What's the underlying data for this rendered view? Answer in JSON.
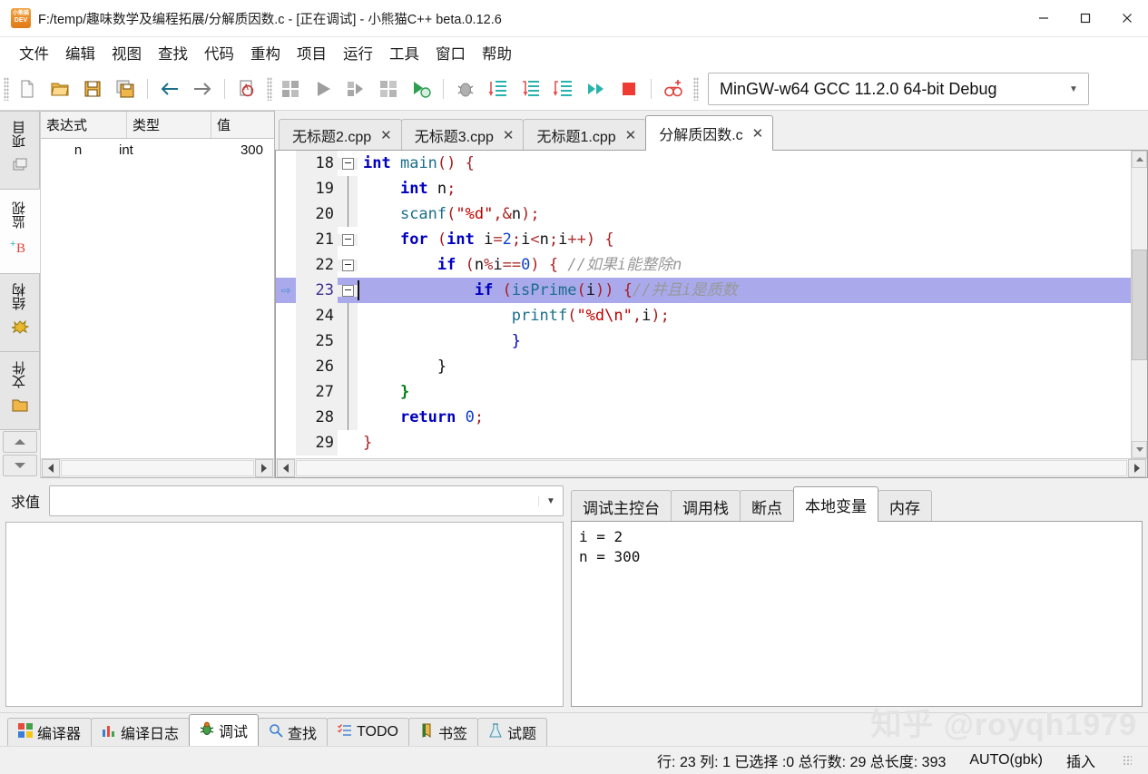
{
  "window": {
    "title": "F:/temp/趣味数学及编程拓展/分解质因数.c - [正在调试] - 小熊猫C++ beta.0.12.6",
    "app_icon": "pandadev-icon",
    "minimize_label": "—",
    "maximize_label": "□",
    "close_label": "✕"
  },
  "menu": {
    "items": [
      {
        "label": "文件",
        "name": "menu-file"
      },
      {
        "label": "编辑",
        "name": "menu-edit"
      },
      {
        "label": "视图",
        "name": "menu-view"
      },
      {
        "label": "查找",
        "name": "menu-search"
      },
      {
        "label": "代码",
        "name": "menu-code"
      },
      {
        "label": "重构",
        "name": "menu-refactor"
      },
      {
        "label": "项目",
        "name": "menu-project"
      },
      {
        "label": "运行",
        "name": "menu-run"
      },
      {
        "label": "工具",
        "name": "menu-tools"
      },
      {
        "label": "窗口",
        "name": "menu-window"
      },
      {
        "label": "帮助",
        "name": "menu-help"
      }
    ]
  },
  "toolbar": {
    "icons": [
      "new-file-icon",
      "open-folder-icon",
      "save-icon",
      "save-all-icon",
      "back-arrow-icon",
      "forward-arrow-icon",
      "find-icon",
      "compile-icon",
      "run-icon",
      "compile-run-icon",
      "rebuild-icon",
      "run-options-icon",
      "debug-bug-icon",
      "step-over-icon",
      "step-into-icon",
      "step-out-icon",
      "continue-icon",
      "stop-icon",
      "add-watch-icon"
    ],
    "compiler_set": "MinGW-w64 GCC 11.2.0 64-bit Debug",
    "compiler_arrow": "▼"
  },
  "left_dock": {
    "vertical_tabs": [
      {
        "label": "项目",
        "icon": "project-files-icon",
        "active": false,
        "name": "sidebar-tab-project"
      },
      {
        "label": "监视",
        "icon": "add-watch-icon",
        "active": true,
        "name": "sidebar-tab-watch"
      },
      {
        "label": "结构",
        "icon": "structure-icon",
        "active": false,
        "name": "sidebar-tab-structure"
      },
      {
        "label": "文件",
        "icon": "folder-icon",
        "active": false,
        "name": "sidebar-tab-files"
      }
    ],
    "scroll_up": "▲",
    "scroll_down": "▼",
    "watch": {
      "columns": [
        "表达式",
        "类型",
        "值"
      ],
      "rows": [
        {
          "expression": "n",
          "type": "int",
          "value": "300"
        }
      ]
    }
  },
  "editor": {
    "tabs": [
      {
        "label": "无标题2.cpp",
        "close": "✕",
        "active": false,
        "name": "editor-tab-untitled2"
      },
      {
        "label": "无标题3.cpp",
        "close": "✕",
        "active": false,
        "name": "editor-tab-untitled3"
      },
      {
        "label": "无标题1.cpp",
        "close": "✕",
        "active": false,
        "name": "editor-tab-untitled1"
      },
      {
        "label": "分解质因数.c",
        "close": "✕",
        "active": true,
        "name": "editor-tab-primefactor"
      }
    ],
    "current_line": 23,
    "lines": [
      {
        "n": "18",
        "marker": "",
        "fold": true,
        "highlight": false
      },
      {
        "n": "19",
        "marker": "",
        "fold": false,
        "highlight": false
      },
      {
        "n": "20",
        "marker": "",
        "fold": false,
        "highlight": false
      },
      {
        "n": "21",
        "marker": "",
        "fold": true,
        "highlight": false
      },
      {
        "n": "22",
        "marker": "",
        "fold": true,
        "highlight": false
      },
      {
        "n": "23",
        "marker": "⇨",
        "fold": true,
        "highlight": true
      },
      {
        "n": "24",
        "marker": "",
        "fold": false,
        "highlight": false
      },
      {
        "n": "25",
        "marker": "",
        "fold": false,
        "highlight": false
      },
      {
        "n": "26",
        "marker": "",
        "fold": false,
        "highlight": false
      },
      {
        "n": "27",
        "marker": "",
        "fold": false,
        "highlight": false
      },
      {
        "n": "28",
        "marker": "",
        "fold": false,
        "highlight": false
      },
      {
        "n": "29",
        "marker": "",
        "fold": false,
        "highlight": false
      }
    ],
    "code_text": [
      "int main() {",
      "    int n;",
      "    scanf(\"%d\",&n);",
      "    for (int i=2;i<n;i++) {",
      "        if (n%i==0) { //如果i能整除n",
      "            if (isPrime(i)) {//并且i是质数",
      "                printf(\"%d\\n\",i);",
      "            }",
      "        }",
      "    }",
      "    return 0;",
      "}"
    ]
  },
  "eval_panel": {
    "label": "求值",
    "input_value": "",
    "input_placeholder": "",
    "arrow": "▼",
    "output": ""
  },
  "debug_panel": {
    "tabs": [
      {
        "label": "调试主控台",
        "active": false,
        "name": "debug-tab-console"
      },
      {
        "label": "调用栈",
        "active": false,
        "name": "debug-tab-callstack"
      },
      {
        "label": "断点",
        "active": false,
        "name": "debug-tab-breakpoints"
      },
      {
        "label": "本地变量",
        "active": true,
        "name": "debug-tab-locals"
      },
      {
        "label": "内存",
        "active": false,
        "name": "debug-tab-memory"
      }
    ],
    "locals_text": "i = 2\nn = 300"
  },
  "bottom_tabs": [
    {
      "label": "编译器",
      "icon": "compiler-icon",
      "active": false,
      "name": "bottom-tab-compiler"
    },
    {
      "label": "编译日志",
      "icon": "build-log-icon",
      "active": false,
      "name": "bottom-tab-buildlog"
    },
    {
      "label": "调试",
      "icon": "bug-icon",
      "active": true,
      "name": "bottom-tab-debug"
    },
    {
      "label": "查找",
      "icon": "search-icon",
      "active": false,
      "name": "bottom-tab-search"
    },
    {
      "label": "TODO",
      "icon": "todo-icon",
      "active": false,
      "name": "bottom-tab-todo"
    },
    {
      "label": "书签",
      "icon": "bookmark-icon",
      "active": false,
      "name": "bottom-tab-bookmark"
    },
    {
      "label": "试题",
      "icon": "problem-set-icon",
      "active": false,
      "name": "bottom-tab-problemset"
    }
  ],
  "watermark": "知乎 @royqh1979",
  "status_bar": {
    "position": "行: 23 列: 1 已选择 :0 总行数: 29 总长度: 393",
    "encoding": "AUTO(gbk)",
    "insert_mode": "插入"
  }
}
